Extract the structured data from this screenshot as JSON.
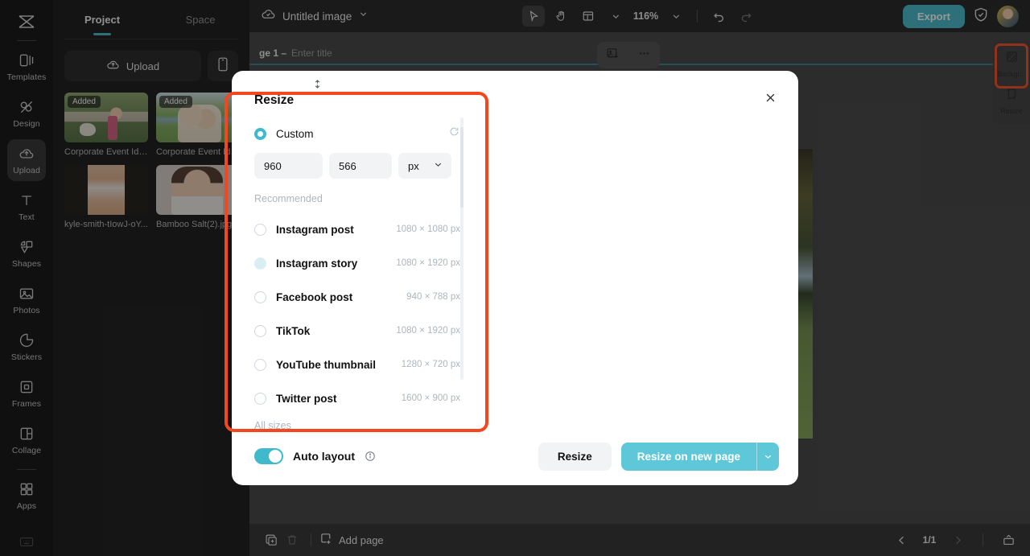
{
  "app": {
    "logo_icon": "capcut-logo-icon"
  },
  "rail": {
    "items": [
      {
        "label": "Templates",
        "icon": "templates-icon"
      },
      {
        "label": "Design",
        "icon": "design-icon"
      },
      {
        "label": "Upload",
        "icon": "upload-cloud-icon"
      },
      {
        "label": "Text",
        "icon": "text-icon"
      },
      {
        "label": "Shapes",
        "icon": "shapes-icon"
      },
      {
        "label": "Photos",
        "icon": "photos-icon"
      },
      {
        "label": "Stickers",
        "icon": "stickers-icon"
      },
      {
        "label": "Frames",
        "icon": "frames-icon"
      },
      {
        "label": "Collage",
        "icon": "collage-icon"
      },
      {
        "label": "Apps",
        "icon": "apps-icon"
      }
    ],
    "active": "Upload"
  },
  "panel": {
    "tabs": [
      {
        "label": "Project",
        "active": true
      },
      {
        "label": "Space",
        "active": false
      }
    ],
    "upload_label": "Upload",
    "upload_icon": "upload-cloud-icon",
    "mobile_icon": "mobile-phone-icon",
    "added_badge": "Added",
    "thumbs": [
      {
        "name": "Corporate Event Idea...",
        "badge": "Added"
      },
      {
        "name": "Corporate Event Ide...",
        "badge": "Added"
      },
      {
        "name": "kyle-smith-tIowJ-oY...",
        "badge": ""
      },
      {
        "name": "Bamboo Salt(2).jpg",
        "badge": ""
      }
    ]
  },
  "toolbar": {
    "cloud_icon": "cloud-saved-icon",
    "doc_title": "Untitled image",
    "title_caret_icon": "chevron-down-icon",
    "select_icon": "cursor-select-icon",
    "hand_icon": "hand-pan-icon",
    "layout_icon": "layout-grid-icon",
    "layout_caret_icon": "chevron-down-icon",
    "zoom_level": "116%",
    "zoom_caret_icon": "chevron-down-icon",
    "undo_icon": "undo-icon",
    "redo_icon": "redo-icon",
    "export_label": "Export",
    "shield_icon": "shield-check-icon",
    "avatar": "user-avatar"
  },
  "page_header": {
    "label": "ge 1 –",
    "title_placeholder": "Enter title",
    "add_image_icon": "add-image-icon",
    "more_icon": "more-horizontal-icon"
  },
  "dock": {
    "items": [
      {
        "label": "Backgr...",
        "icon": "background-icon"
      },
      {
        "label": "Resize",
        "icon": "resize-icon"
      }
    ]
  },
  "bottom_bar": {
    "duplicate_icon": "duplicate-page-icon",
    "delete_icon": "trash-icon",
    "add_page_label": "Add page",
    "add_page_icon": "add-page-icon",
    "prev_icon": "chevron-left-icon",
    "next_icon": "chevron-right-icon",
    "page_indicator": "1/1",
    "present_icon": "present-icon"
  },
  "modal": {
    "title": "Resize",
    "close_icon": "close-icon",
    "custom_label": "Custom",
    "reset_icon": "reset-icon",
    "width_value": "960",
    "height_value": "566",
    "swap_icon": "swap-vertical-icon",
    "unit_value": "px",
    "unit_caret_icon": "chevron-down-icon",
    "recommended_label": "Recommended",
    "sizes": [
      {
        "name": "Instagram post",
        "dim": "1080 × 1080 px",
        "state": "off"
      },
      {
        "name": "Instagram story",
        "dim": "1080 × 1920 px",
        "state": "hover"
      },
      {
        "name": "Facebook post",
        "dim": "940 × 788 px",
        "state": "off"
      },
      {
        "name": "TikTok",
        "dim": "1080 × 1920 px",
        "state": "off"
      },
      {
        "name": "YouTube thumbnail",
        "dim": "1280 × 720 px",
        "state": "off"
      },
      {
        "name": "Twitter post",
        "dim": "1600 × 900 px",
        "state": "off"
      }
    ],
    "all_sizes_label": "All sizes",
    "auto_layout_label": "Auto layout",
    "auto_layout_info_icon": "info-icon",
    "auto_layout_on": true,
    "btn_resize": "Resize",
    "btn_resize_new_page": "Resize on new page",
    "btn_caret_icon": "chevron-down-icon"
  },
  "colors": {
    "accent": "#3fb9cb",
    "accent_button": "#5ec8d8",
    "highlight": "#f4471f",
    "panel_dark": "#111111",
    "rail_dark": "#0a0a0a"
  }
}
